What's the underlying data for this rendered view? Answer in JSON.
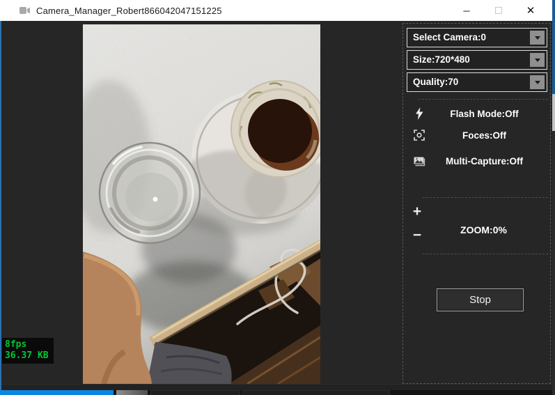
{
  "window": {
    "title": "Camera_Manager_Robert866042047151225",
    "controls": {
      "minimize": "─",
      "close": "✕"
    }
  },
  "stats": {
    "fps": "8fps",
    "bandwidth": "36.37 KB"
  },
  "video": {
    "alt": "Live camera feed: top-down view of a glass of water and a cup of coffee on a speckled table"
  },
  "sidebar": {
    "dropdowns": [
      {
        "label": "Select Camera:0"
      },
      {
        "label": "Size:720*480"
      },
      {
        "label": "Quality:70"
      }
    ],
    "settings": [
      {
        "icon": "flash-icon",
        "label": "Flash Mode:Off"
      },
      {
        "icon": "focus-icon",
        "label": "Foces:Off"
      },
      {
        "icon": "multi-capture-icon",
        "label": "Multi-Capture:Off"
      }
    ],
    "zoom": {
      "plus": "+",
      "minus": "−",
      "label": "ZOOM:0%"
    },
    "stop_button": "Stop"
  },
  "colors": {
    "stats_green": "#00c832",
    "taskbar_blue": "#0b86e0",
    "panel_bg": "#262626",
    "titlebar_bg": "#ffffff"
  }
}
